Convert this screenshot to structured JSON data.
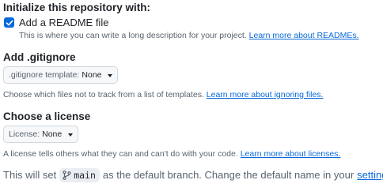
{
  "init": {
    "heading": "Initialize this repository with:",
    "readme": {
      "checked": true,
      "label": "Add a README file",
      "description": "This is where you can write a long description for your project.",
      "link": "Learn more about READMEs."
    }
  },
  "gitignore": {
    "heading": "Add .gitignore",
    "dropdown_label": ".gitignore template:",
    "dropdown_value": "None",
    "description": "Choose which files not to track from a list of templates.",
    "link": "Learn more about ignoring files."
  },
  "license": {
    "heading": "Choose a license",
    "dropdown_label": "License:",
    "dropdown_value": "None",
    "description": "A license tells others what they can and can't do with your code.",
    "link": "Learn more about licenses."
  },
  "footer": {
    "prefix": "This will set",
    "branch": "main",
    "suffix": "as the default branch. Change the default name in your",
    "link": "settings",
    "end": "."
  },
  "colors": {
    "accent": "#0969da",
    "text": "#1f2328",
    "muted": "#59636e"
  },
  "icons": {
    "check": "check-icon",
    "caret": "triangle-down-icon",
    "branch": "git-branch-icon"
  }
}
